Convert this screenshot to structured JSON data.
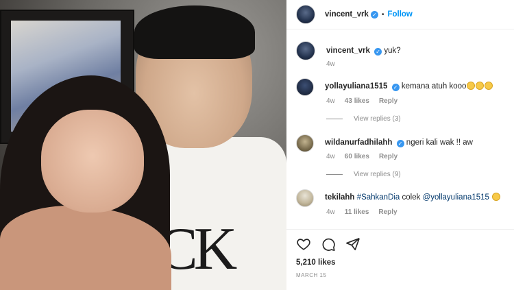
{
  "header": {
    "username": "vincent_vrk",
    "separator": "•",
    "follow_label": "Follow"
  },
  "caption": {
    "username": "vincent_vrk",
    "text": "yuk?",
    "time": "4w"
  },
  "comments": [
    {
      "username": "yollayuliana1515",
      "text": "kemana atuh kooo",
      "time": "4w",
      "likes": "43 likes",
      "reply_label": "Reply",
      "view_replies": "View replies (3)"
    },
    {
      "username": "wildanurfadhilahh",
      "text": "ngeri kali wak !! aw",
      "time": "4w",
      "likes": "60 likes",
      "reply_label": "Reply",
      "view_replies": "View replies (9)"
    },
    {
      "username": "tekilahh",
      "text_hashtag": "#SahkanDia",
      "text_mid": "colek",
      "text_mention": "@yollayuliana1515",
      "time": "4w",
      "likes": "11 likes",
      "reply_label": "Reply"
    }
  ],
  "footer": {
    "likes": "5,210 likes",
    "date": "MARCH 15"
  },
  "icons": [
    "heart-icon",
    "comment-icon",
    "share-icon",
    "verified-icon",
    "grinning-emoji-icon"
  ],
  "colors": {
    "accent": "#0095f6",
    "verified": "#3897f0",
    "muted": "#8e8e8e",
    "text": "#262626",
    "mention": "#00376b"
  }
}
